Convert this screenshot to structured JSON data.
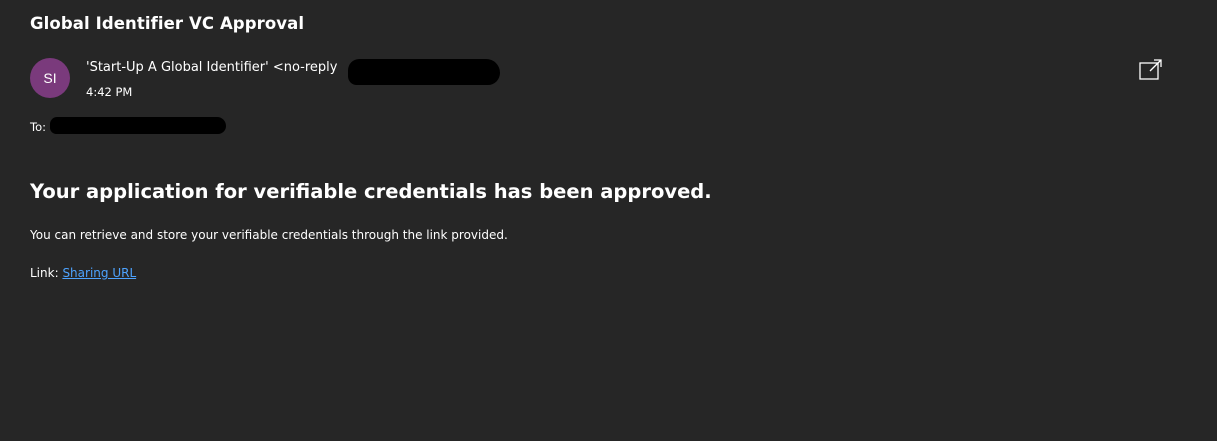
{
  "email": {
    "subject": "Global Identifier VC Approval",
    "sender": {
      "initials": "SI",
      "display": "'Start-Up A Global Identifier'  <no-reply"
    },
    "time": "4:42 PM",
    "to_label": "To: ",
    "icons": {
      "popout": "popout-window-icon"
    }
  },
  "body": {
    "headline": "Your application for verifiable credentials has been approved.",
    "paragraph": "You can retrieve and store your verifiable credentials through the link provided.",
    "link_label": "Link: ",
    "link_text": "Sharing URL"
  },
  "colors": {
    "background": "#262626",
    "avatar": "#7a3a7c",
    "link": "#4da3ff"
  }
}
